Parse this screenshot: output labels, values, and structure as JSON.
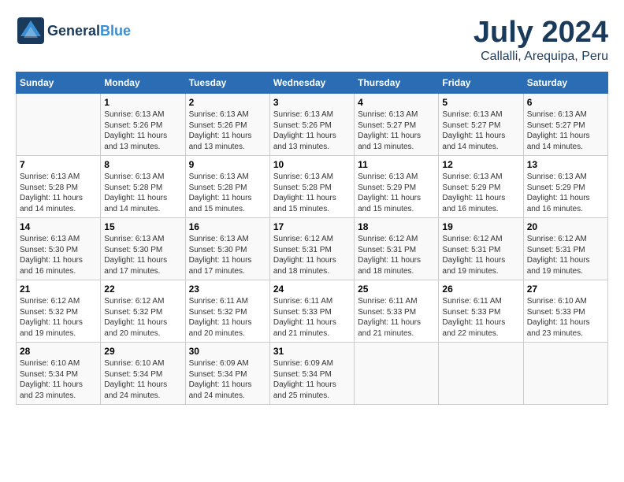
{
  "logo": {
    "general": "General",
    "blue": "Blue",
    "tagline": ""
  },
  "title": "July 2024",
  "subtitle": "Callalli, Arequipa, Peru",
  "days": [
    "Sunday",
    "Monday",
    "Tuesday",
    "Wednesday",
    "Thursday",
    "Friday",
    "Saturday"
  ],
  "weeks": [
    [
      {
        "date": "",
        "info": ""
      },
      {
        "date": "1",
        "info": "Sunrise: 6:13 AM\nSunset: 5:26 PM\nDaylight: 11 hours\nand 13 minutes."
      },
      {
        "date": "2",
        "info": "Sunrise: 6:13 AM\nSunset: 5:26 PM\nDaylight: 11 hours\nand 13 minutes."
      },
      {
        "date": "3",
        "info": "Sunrise: 6:13 AM\nSunset: 5:26 PM\nDaylight: 11 hours\nand 13 minutes."
      },
      {
        "date": "4",
        "info": "Sunrise: 6:13 AM\nSunset: 5:27 PM\nDaylight: 11 hours\nand 13 minutes."
      },
      {
        "date": "5",
        "info": "Sunrise: 6:13 AM\nSunset: 5:27 PM\nDaylight: 11 hours\nand 14 minutes."
      },
      {
        "date": "6",
        "info": "Sunrise: 6:13 AM\nSunset: 5:27 PM\nDaylight: 11 hours\nand 14 minutes."
      }
    ],
    [
      {
        "date": "7",
        "info": "Sunrise: 6:13 AM\nSunset: 5:28 PM\nDaylight: 11 hours\nand 14 minutes."
      },
      {
        "date": "8",
        "info": "Sunrise: 6:13 AM\nSunset: 5:28 PM\nDaylight: 11 hours\nand 14 minutes."
      },
      {
        "date": "9",
        "info": "Sunrise: 6:13 AM\nSunset: 5:28 PM\nDaylight: 11 hours\nand 15 minutes."
      },
      {
        "date": "10",
        "info": "Sunrise: 6:13 AM\nSunset: 5:28 PM\nDaylight: 11 hours\nand 15 minutes."
      },
      {
        "date": "11",
        "info": "Sunrise: 6:13 AM\nSunset: 5:29 PM\nDaylight: 11 hours\nand 15 minutes."
      },
      {
        "date": "12",
        "info": "Sunrise: 6:13 AM\nSunset: 5:29 PM\nDaylight: 11 hours\nand 16 minutes."
      },
      {
        "date": "13",
        "info": "Sunrise: 6:13 AM\nSunset: 5:29 PM\nDaylight: 11 hours\nand 16 minutes."
      }
    ],
    [
      {
        "date": "14",
        "info": "Sunrise: 6:13 AM\nSunset: 5:30 PM\nDaylight: 11 hours\nand 16 minutes."
      },
      {
        "date": "15",
        "info": "Sunrise: 6:13 AM\nSunset: 5:30 PM\nDaylight: 11 hours\nand 17 minutes."
      },
      {
        "date": "16",
        "info": "Sunrise: 6:13 AM\nSunset: 5:30 PM\nDaylight: 11 hours\nand 17 minutes."
      },
      {
        "date": "17",
        "info": "Sunrise: 6:12 AM\nSunset: 5:31 PM\nDaylight: 11 hours\nand 18 minutes."
      },
      {
        "date": "18",
        "info": "Sunrise: 6:12 AM\nSunset: 5:31 PM\nDaylight: 11 hours\nand 18 minutes."
      },
      {
        "date": "19",
        "info": "Sunrise: 6:12 AM\nSunset: 5:31 PM\nDaylight: 11 hours\nand 19 minutes."
      },
      {
        "date": "20",
        "info": "Sunrise: 6:12 AM\nSunset: 5:31 PM\nDaylight: 11 hours\nand 19 minutes."
      }
    ],
    [
      {
        "date": "21",
        "info": "Sunrise: 6:12 AM\nSunset: 5:32 PM\nDaylight: 11 hours\nand 19 minutes."
      },
      {
        "date": "22",
        "info": "Sunrise: 6:12 AM\nSunset: 5:32 PM\nDaylight: 11 hours\nand 20 minutes."
      },
      {
        "date": "23",
        "info": "Sunrise: 6:11 AM\nSunset: 5:32 PM\nDaylight: 11 hours\nand 20 minutes."
      },
      {
        "date": "24",
        "info": "Sunrise: 6:11 AM\nSunset: 5:33 PM\nDaylight: 11 hours\nand 21 minutes."
      },
      {
        "date": "25",
        "info": "Sunrise: 6:11 AM\nSunset: 5:33 PM\nDaylight: 11 hours\nand 21 minutes."
      },
      {
        "date": "26",
        "info": "Sunrise: 6:11 AM\nSunset: 5:33 PM\nDaylight: 11 hours\nand 22 minutes."
      },
      {
        "date": "27",
        "info": "Sunrise: 6:10 AM\nSunset: 5:33 PM\nDaylight: 11 hours\nand 23 minutes."
      }
    ],
    [
      {
        "date": "28",
        "info": "Sunrise: 6:10 AM\nSunset: 5:34 PM\nDaylight: 11 hours\nand 23 minutes."
      },
      {
        "date": "29",
        "info": "Sunrise: 6:10 AM\nSunset: 5:34 PM\nDaylight: 11 hours\nand 24 minutes."
      },
      {
        "date": "30",
        "info": "Sunrise: 6:09 AM\nSunset: 5:34 PM\nDaylight: 11 hours\nand 24 minutes."
      },
      {
        "date": "31",
        "info": "Sunrise: 6:09 AM\nSunset: 5:34 PM\nDaylight: 11 hours\nand 25 minutes."
      },
      {
        "date": "",
        "info": ""
      },
      {
        "date": "",
        "info": ""
      },
      {
        "date": "",
        "info": ""
      }
    ]
  ]
}
